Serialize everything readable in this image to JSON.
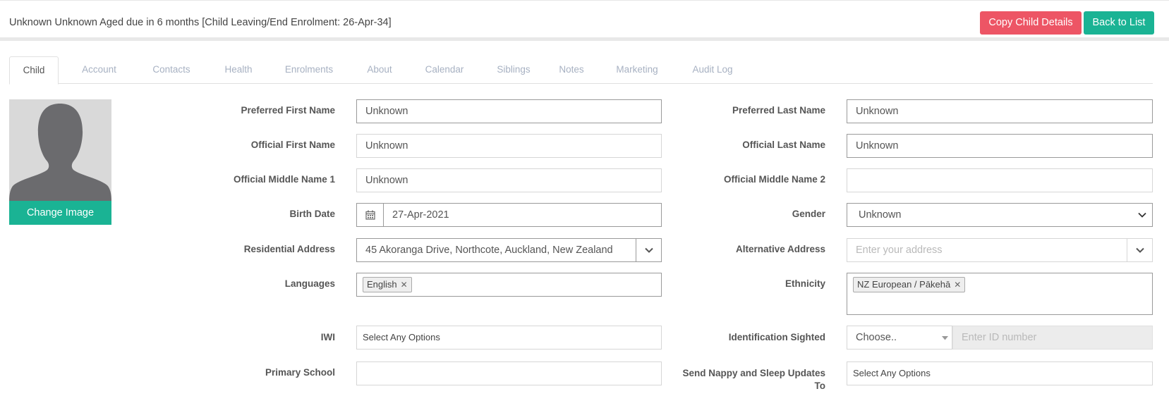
{
  "header": {
    "title": "Unknown Unknown Aged due in 6 months [Child Leaving/End Enrolment: 26-Apr-34]",
    "copy_button": "Copy Child Details",
    "back_button": "Back to List"
  },
  "tabs": [
    "Child",
    "Account",
    "Contacts",
    "Health",
    "Enrolments",
    "About",
    "Calendar",
    "Siblings",
    "Notes",
    "Marketing",
    "Audit Log"
  ],
  "active_tab": "Child",
  "avatar": {
    "change_image_label": "Change Image"
  },
  "form": {
    "preferred_first_name": {
      "label": "Preferred First Name",
      "value": "Unknown"
    },
    "preferred_last_name": {
      "label": "Preferred Last Name",
      "value": "Unknown"
    },
    "official_first_name": {
      "label": "Official First Name",
      "value": "Unknown"
    },
    "official_last_name": {
      "label": "Official Last Name",
      "value": "Unknown"
    },
    "official_middle_name_1": {
      "label": "Official Middle Name 1",
      "value": "Unknown"
    },
    "official_middle_name_2": {
      "label": "Official Middle Name 2",
      "value": ""
    },
    "birth_date": {
      "label": "Birth Date",
      "value": "27-Apr-2021"
    },
    "gender": {
      "label": "Gender",
      "value": "Unknown"
    },
    "residential_address": {
      "label": "Residential Address",
      "value": "45 Akoranga Drive, Northcote, Auckland, New Zealand"
    },
    "alternative_address": {
      "label": "Alternative Address",
      "placeholder": "Enter your address"
    },
    "languages": {
      "label": "Languages",
      "tags": [
        "English"
      ]
    },
    "ethnicity": {
      "label": "Ethnicity",
      "tags": [
        "NZ European / Pākehā"
      ]
    },
    "iwi": {
      "label": "IWI",
      "placeholder": "Select Any Options"
    },
    "identification_sighted": {
      "label": "Identification Sighted",
      "select_value": "Choose..",
      "id_placeholder": "Enter ID number"
    },
    "primary_school": {
      "label": "Primary School",
      "value": ""
    },
    "send_nappy_sleep": {
      "label": "Send Nappy and Sleep Updates",
      "label_line2": "To",
      "placeholder": "Select Any Options"
    }
  },
  "icons": {
    "calendar": "calendar-icon",
    "chevron": "chevron-down-icon",
    "tag_remove": "close-icon",
    "avatar": "person-silhouette-icon"
  },
  "colors": {
    "danger": "#ed5565",
    "primary": "#1ab394",
    "tab_inactive": "#a7b1c2"
  }
}
